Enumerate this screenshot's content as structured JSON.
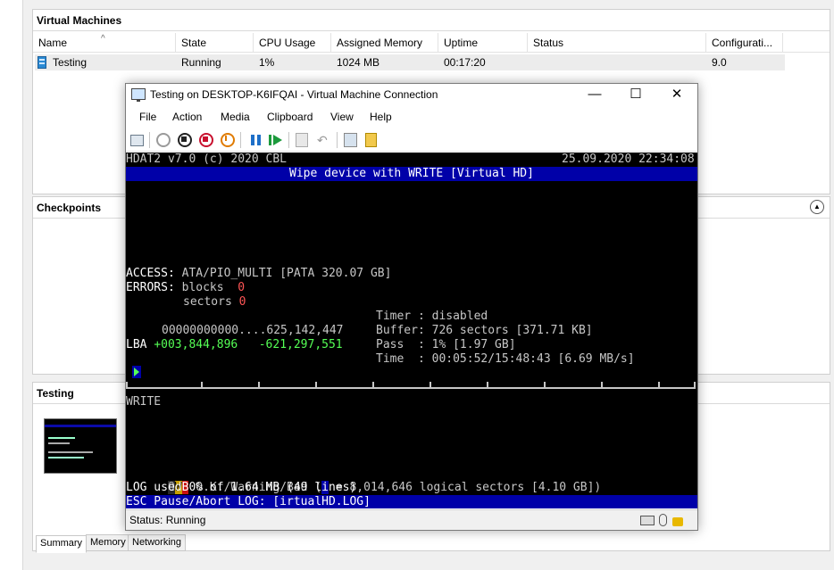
{
  "vm_panel": {
    "title": "Virtual Machines",
    "columns": [
      "Name",
      "State",
      "CPU Usage",
      "Assigned Memory",
      "Uptime",
      "Status",
      "Configurati..."
    ],
    "rows": [
      {
        "name": "Testing",
        "state": "Running",
        "cpu": "1%",
        "memory": "1024 MB",
        "uptime": "00:17:20",
        "status": "",
        "config": "9.0"
      }
    ]
  },
  "checkpoints_panel": {
    "title": "Checkpoints"
  },
  "detail_panel": {
    "title": "Testing"
  },
  "detail_tabs": [
    "Summary",
    "Memory",
    "Networking"
  ],
  "vm_window": {
    "title": "Testing on DESKTOP-K6IFQAI - Virtual Machine Connection",
    "menu": [
      "File",
      "Action",
      "Media",
      "Clipboard",
      "View",
      "Help"
    ],
    "status": "Status: Running"
  },
  "console": {
    "header_left": "HDAT2 v7.0 (c) 2020 CBL",
    "header_right": "25.09.2020 22:34:08",
    "banner": "Wipe device with WRITE [Virtual HD]",
    "access_label": "ACCESS:",
    "access_value": "ATA/PIO_MULTI [PATA 320.07 GB]",
    "errors_label": "ERRORS:",
    "blocks_label": "blocks",
    "blocks_value": "0",
    "sectors_label": "sectors",
    "sectors_value": "0",
    "range": "00000000000....625,142,447",
    "lba_label": "LBA",
    "lba_pos": "+003,844,896",
    "lba_remaining": "-621,297,551",
    "timer_line": "Timer : disabled",
    "buffer_line": "Buffer: 726 sectors [371.71 KB]",
    "pass_line": "Pass  : 1% [1.97 GB]",
    "time_line": "Time  : 00:05:52/15:48:43 [6.69 MB/s]",
    "mode": "WRITE",
    "legend_ok": "O",
    "legend_warn": "W",
    "legend_bad": "B",
    "legend_text": " O.K./Warning/Bad (",
    "legend_sectors": " = 8,014,646 logical sectors [4.10 GB])",
    "log_line": "LOG used 0% of 1.64 MB (49 lines)",
    "footer": "ESC Pause/Abort LOG: [irtualHD.LOG]"
  },
  "colors": {
    "console_blue": "#0000a8",
    "console_green": "#55ff55",
    "console_red": "#ff5555"
  }
}
